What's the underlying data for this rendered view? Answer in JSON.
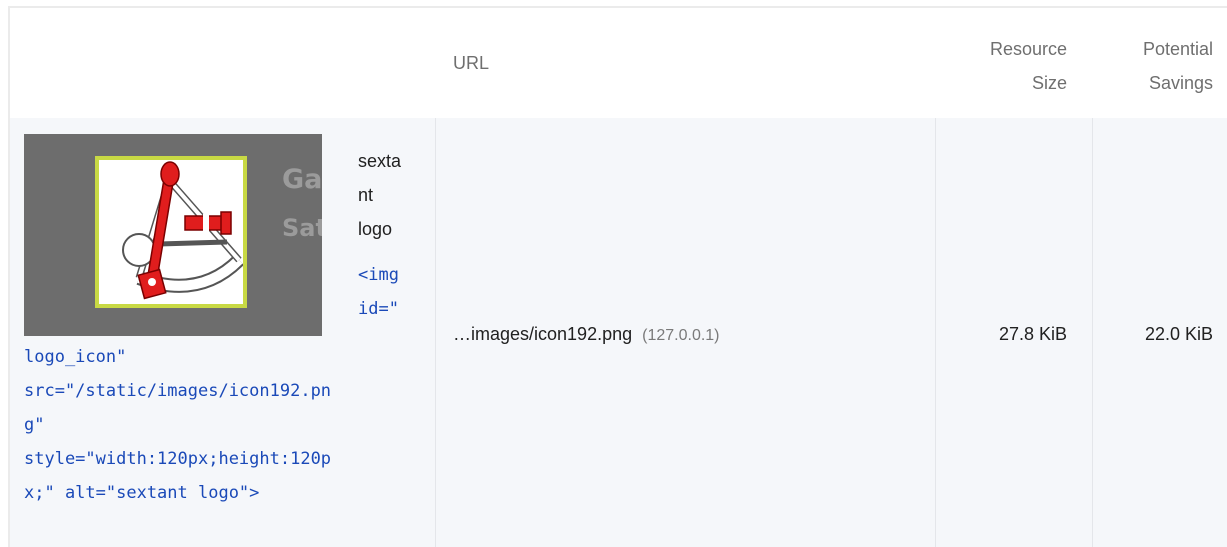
{
  "table": {
    "headers": {
      "url": "URL",
      "resource_size_line1": "Resource",
      "resource_size_line2": "Size",
      "potential_savings_line1": "Potential",
      "potential_savings_line2": "Savings"
    },
    "row": {
      "thumbnail_ghost_text_1": "Ga",
      "thumbnail_ghost_text_2": "Sat",
      "alt_lines": [
        "sexta",
        "nt",
        "logo"
      ],
      "snippet_head_lines": [
        "<img",
        "id=\""
      ],
      "snippet_tail_lines": [
        "logo_icon\"",
        "src=\"/static/images/icon192.pn",
        "g\"",
        "style=\"width:120px;height:120p",
        "x;\" alt=\"sextant logo\">"
      ],
      "url": "…images/icon192.png",
      "host": "(127.0.0.1)",
      "resource_size": "27.8 KiB",
      "potential_savings": "22.0 KiB"
    }
  },
  "colors": {
    "code": "#1a49b8",
    "logo_border": "#c8d944",
    "logo_red": "#e01d1d",
    "thumb_bg": "#6d6d6d"
  },
  "icons": {
    "thumbnail": "sextant-logo-icon"
  }
}
